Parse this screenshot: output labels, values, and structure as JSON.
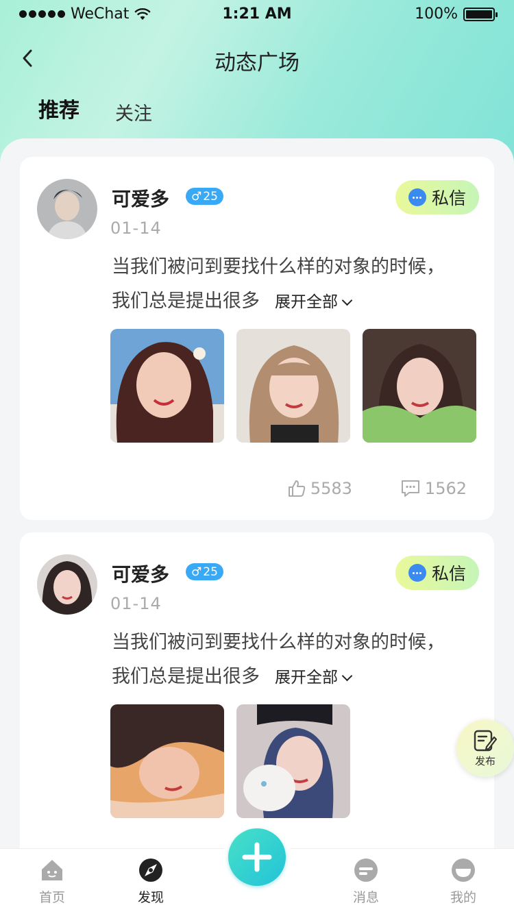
{
  "status_bar": {
    "carrier": "WeChat",
    "time": "1:21 AM",
    "battery": "100%"
  },
  "nav": {
    "title": "动态广场"
  },
  "tabs": [
    {
      "label": "推荐",
      "active": true
    },
    {
      "label": "关注",
      "active": false
    }
  ],
  "posts": [
    {
      "name": "可爱多",
      "gender_symbol": "♂",
      "age": "25",
      "date": "01-14",
      "dm_label": "私信",
      "text_line1": "当我们被问到要找什么样的对象的时候，",
      "text_line2": "我们总是提出很多",
      "expand_label": "展开全部",
      "likes": "5583",
      "comments": "1562"
    },
    {
      "name": "可爱多",
      "gender_symbol": "♂",
      "age": "25",
      "date": "01-14",
      "dm_label": "私信",
      "text_line1": "当我们被问到要找什么样的对象的时候，",
      "text_line2": "我们总是提出很多",
      "expand_label": "展开全部"
    }
  ],
  "publish": {
    "label": "发布"
  },
  "tabbar": {
    "items": [
      {
        "label": "首页",
        "icon": "home-icon",
        "active": false
      },
      {
        "label": "发现",
        "icon": "discover-icon",
        "active": true
      },
      {
        "label": "消息",
        "icon": "message-icon",
        "active": false
      },
      {
        "label": "我的",
        "icon": "profile-icon",
        "active": false
      }
    ]
  },
  "colors": {
    "accent": "#1ec7c6",
    "badge": "#3aa9f5",
    "header_bg": "#9beadb"
  }
}
